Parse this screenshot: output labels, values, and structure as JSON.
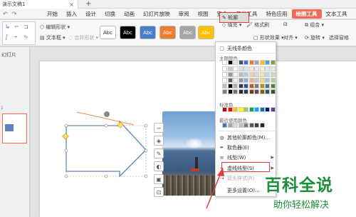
{
  "document_tab": {
    "title": "演示文稿1",
    "close": "×",
    "new_tab": "+"
  },
  "quick_access": {
    "undo": "↶",
    "redo": "↷"
  },
  "menu": [
    "开始",
    "插入",
    "设计",
    "切换",
    "动画",
    "幻灯片放映",
    "审阅",
    "视图",
    "安全",
    "开发工具",
    "特色应用",
    "绘图工具",
    "文本工具"
  ],
  "menu_active": "绘图工具",
  "ribbon": {
    "edit_shape": "编辑形状",
    "text_box": "文本框",
    "merge_shape": "合并形状",
    "style_label": "Abc",
    "fill": "填充",
    "format_painter": "格式刷",
    "outline": "轮廓",
    "shape_effect": "形状效果",
    "group": "组合",
    "rotate": "旋转",
    "align": "对齐",
    "select_pane": "选择窗格"
  },
  "swatches": [
    {
      "label": "Abc",
      "bg": "#ffffff",
      "fg": "#333333"
    },
    {
      "label": "Abc",
      "bg": "#000000",
      "fg": "#ffffff"
    },
    {
      "label": "Abc",
      "bg": "#4a7ec8",
      "fg": "#ffffff"
    },
    {
      "label": "Abc",
      "bg": "#ed7d31",
      "fg": "#ffffff"
    },
    {
      "label": "Abc",
      "bg": "#a5a5a5",
      "fg": "#ffffff"
    },
    {
      "label": "Abc",
      "bg": "#ffc000",
      "fg": "#ffffff"
    }
  ],
  "left_panel": {
    "tab": "幻灯片",
    "slide_number": "1"
  },
  "context_menu": {
    "no_outline": "无线条颜色",
    "theme_colors": "主题颜色",
    "standard_colors": "标准色",
    "recent_colors": "最近使用颜色",
    "more_colors": "其他轮廓颜色(M)...",
    "eyedropper": "取色器(E)",
    "line_style": "线型(W)",
    "dash_style": "虚线线型(S)",
    "arrow_style": "箭头样式(R)",
    "more_settings": "更多设置(O)..."
  },
  "accent_color": "#ef6b55",
  "highlight_color": "#e53a3a",
  "watermark": {
    "title": "百科全说",
    "subtitle": "助你轻松解决"
  }
}
